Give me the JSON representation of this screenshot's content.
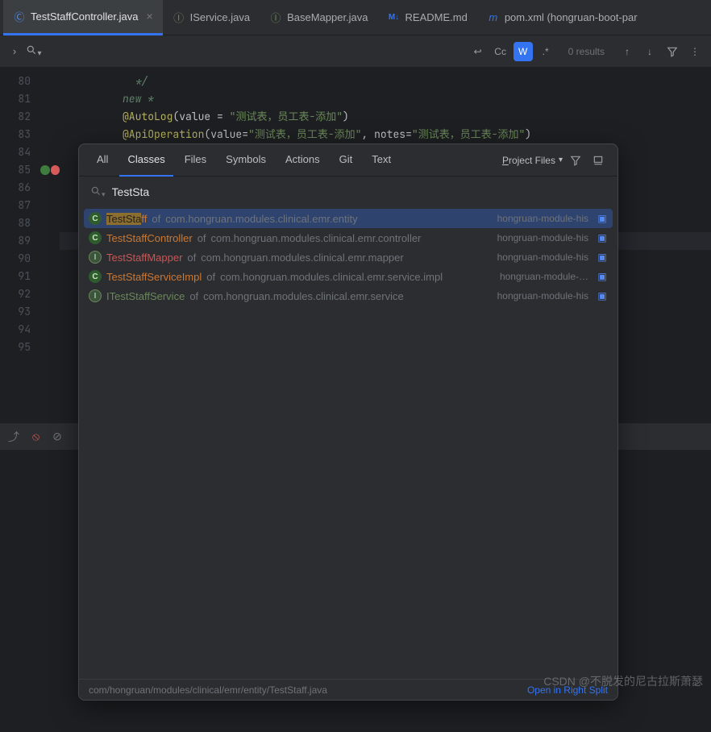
{
  "tabs": [
    {
      "label": "TestStaffController.java",
      "icon": "C",
      "iconColor": "#548af7",
      "active": true
    },
    {
      "label": "IService.java",
      "icon": "I",
      "iconColor": "#6a8759",
      "active": false
    },
    {
      "label": "BaseMapper.java",
      "icon": "I",
      "iconColor": "#6a8759",
      "active": false
    },
    {
      "label": "README.md",
      "icon": "M↓",
      "iconColor": "#3574f0",
      "active": false
    },
    {
      "label": "pom.xml (hongruan-boot-par",
      "icon": "m",
      "iconColor": "#3574f0",
      "active": false
    }
  ],
  "findBar": {
    "resultsText": "0 results"
  },
  "gutter": {
    "start": 80,
    "end": 95,
    "markLine": 85
  },
  "code": {
    "l80": "*/",
    "l81_new": "new *",
    "ann_autolog": "@AutoLog",
    "ann_apiop": "@ApiOperation",
    "kw_value": "value",
    "kw_notes": "notes",
    "str1": "\"测试表，员工表-添加\"",
    "str2": "\"测试表，员工表-添加\"",
    "str3": "\"测试表，员工表-添加\""
  },
  "searchEverywhere": {
    "tabs": [
      "All",
      "Classes",
      "Files",
      "Symbols",
      "Actions",
      "Git",
      "Text"
    ],
    "activeTab": "Classes",
    "scopeLabel": "Project Files",
    "scopeUnderline": "P",
    "query": "TestSta",
    "results": [
      {
        "kind": "class",
        "nameHl": "TestSta",
        "nameRest": "ff",
        "of": "of",
        "pkg": "com.hongruan.modules.clinical.emr.entity",
        "module": "hongruan-module-his",
        "selected": true,
        "nameColor": "yellow"
      },
      {
        "kind": "class",
        "nameHl": "",
        "nameRest": "TestStaffController",
        "of": "of",
        "pkg": "com.hongruan.modules.clinical.emr.controller",
        "module": "hongruan-module-his",
        "selected": false,
        "nameColor": "yellow"
      },
      {
        "kind": "interface",
        "nameHl": "",
        "nameRest": "TestStaffMapper",
        "of": "of",
        "pkg": "com.hongruan.modules.clinical.emr.mapper",
        "module": "hongruan-module-his",
        "selected": false,
        "nameColor": "red"
      },
      {
        "kind": "class",
        "nameHl": "",
        "nameRest": "TestStaffServiceImpl",
        "of": "of",
        "pkg": "com.hongruan.modules.clinical.emr.service.impl",
        "module": "hongruan-module-…",
        "selected": false,
        "nameColor": "yellow"
      },
      {
        "kind": "interface",
        "nameHl": "",
        "nameRest": "ITestStaffService",
        "of": "of",
        "pkg": "com.hongruan.modules.clinical.emr.service",
        "module": "hongruan-module-his",
        "selected": false,
        "nameColor": "green"
      }
    ],
    "footerPath": "com/hongruan/modules/clinical/emr/entity/TestStaff.java",
    "footerAction": "Open in Right Split"
  },
  "watermark": "CSDN @不脱发的尼古拉斯萧瑟"
}
